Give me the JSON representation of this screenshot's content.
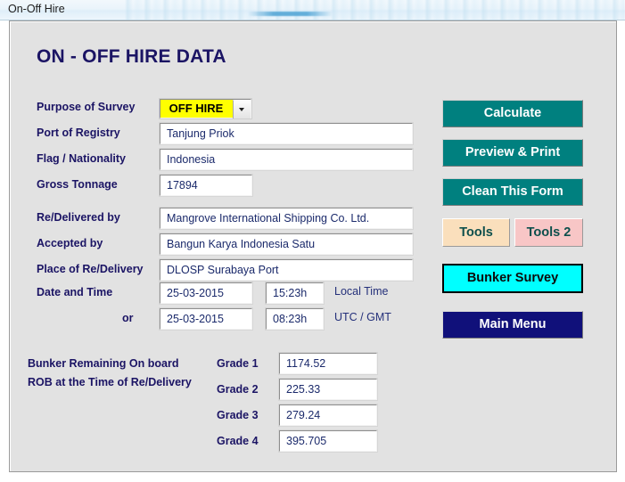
{
  "window": {
    "title": "On-Off Hire"
  },
  "form": {
    "title": "ON - OFF HIRE DATA",
    "fields": {
      "purpose_label": "Purpose of Survey",
      "purpose_value": "OFF HIRE",
      "port_label": "Port of Registry",
      "port_value": "Tanjung Priok",
      "flag_label": "Flag / Nationality",
      "flag_value": "Indonesia",
      "tonnage_label": "Gross Tonnage",
      "tonnage_value": "17894",
      "redelivered_label": "Re/Delivered by",
      "redelivered_value": "Mangrove International Shipping Co. Ltd.",
      "accepted_label": "Accepted by",
      "accepted_value": "Bangun Karya Indonesia Satu",
      "place_label": "Place of Re/Delivery",
      "place_value": "DLOSP Surabaya Port"
    },
    "datetime": {
      "label": "Date and Time",
      "or_label": "or",
      "local_date": "25-03-2015",
      "local_time": "15:23h",
      "local_zone_label": "Local Time",
      "utc_date": "25-03-2015",
      "utc_time": "08:23h",
      "utc_zone_label": "UTC / GMT"
    },
    "bunker": {
      "heading_line1": "Bunker Remaining On board",
      "heading_line2": "ROB at the Time of Re/Delivery",
      "grades": [
        {
          "label": "Grade 1",
          "value": "1174.52"
        },
        {
          "label": "Grade 2",
          "value": "225.33"
        },
        {
          "label": "Grade 3",
          "value": "279.24"
        },
        {
          "label": "Grade 4",
          "value": "395.705"
        }
      ]
    }
  },
  "buttons": {
    "calculate": "Calculate",
    "preview_print": "Preview & Print",
    "clean_form": "Clean This Form",
    "tools": "Tools",
    "tools2": "Tools 2",
    "bunker_survey": "Bunker Survey",
    "main_menu": "Main Menu"
  },
  "colors": {
    "heading": "#1b1464",
    "teal_button": "#00807f",
    "tools_button": "#fadfbc",
    "tools2_button": "#f8c6c6",
    "bunker_button": "#00ffff",
    "main_menu_button": "#10107a",
    "combo_highlight": "#ffff00",
    "panel_background": "#e2e2e2"
  }
}
